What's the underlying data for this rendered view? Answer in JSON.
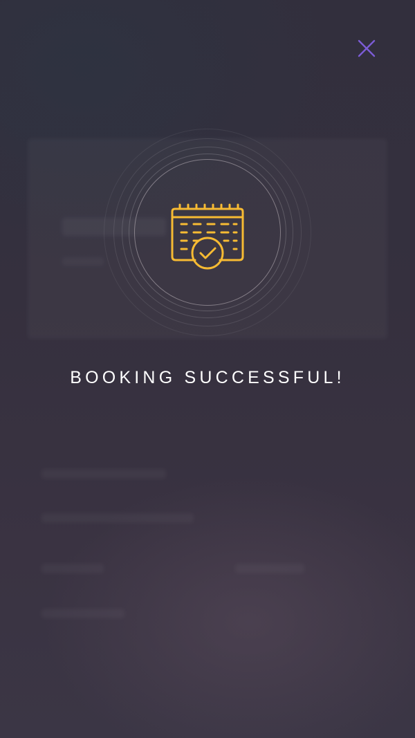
{
  "dialog": {
    "title": "BOOKING SUCCESSFUL!",
    "close_icon": "close-icon",
    "status_icon": "calendar-check-icon"
  },
  "colors": {
    "accent": "#F7BB33",
    "close": "#7C5CD6",
    "text": "#FFFFFF",
    "background": "#34303E"
  }
}
